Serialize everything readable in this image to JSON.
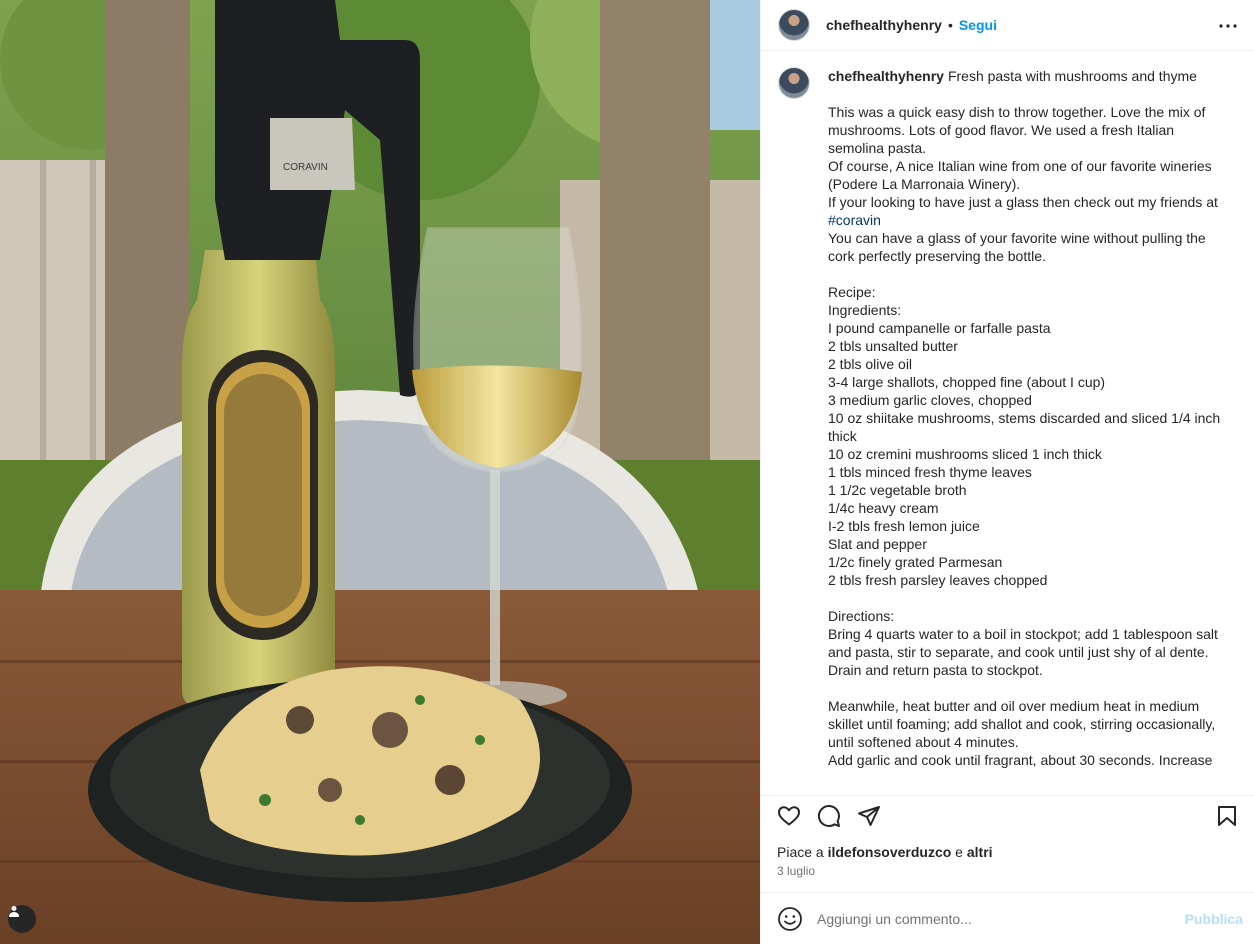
{
  "post": {
    "username": "chefhealthyhenry",
    "separator": "•",
    "follow_label": "Segui",
    "caption": {
      "username": "chefhealthyhenry",
      "title": "Fresh pasta with mushrooms and thyme",
      "line1": "This was a quick easy dish to throw together. Love the mix of mushrooms. Lots of good flavor. We used a fresh Italian semolina pasta.",
      "line2": "Of course, A nice Italian wine from one of our favorite wineries (Podere La Marronaia Winery).",
      "line3_prefix": "If your looking to have just a glass then check out my friends at ",
      "hashtag": "#coravin",
      "line4": "You can have a glass of your favorite wine without pulling the cork perfectly preserving the bottle.",
      "recipe_heading": "Recipe:",
      "ingredients_heading": "Ingredients:",
      "ingredients": [
        "I pound campanelle or farfalle pasta",
        "2 tbls unsalted butter",
        "2 tbls olive oil",
        "3-4 large shallots, chopped fine (about I cup)",
        "3 medium garlic cloves, chopped",
        "10 oz shiitake mushrooms, stems discarded and sliced 1/4 inch thick",
        "10 oz cremini mushrooms sliced 1 inch thick",
        "1 tbls minced fresh thyme leaves",
        "1 1/2c vegetable broth",
        "1/4c heavy cream",
        "I-2 tbls fresh lemon juice",
        "Slat and pepper",
        "1/2c finely grated Parmesan",
        "2 tbls fresh parsley leaves chopped"
      ],
      "directions_heading": "Directions:",
      "directions": [
        "Bring 4 quarts water to a boil in stockpot; add 1 tablespoon salt and pasta, stir to separate, and cook until just shy of al dente.",
        "Drain and return pasta to stockpot.",
        "",
        "Meanwhile, heat butter and oil over medium heat in medium skillet until foaming; add shallot and cook, stirring occasionally, until softened about 4 minutes.",
        "Add garlic and cook until fragrant, about 30 seconds. Increase"
      ]
    },
    "likes": {
      "prefix": "Piace a ",
      "user": "ildefonsoverduzco",
      "conjunction": " e ",
      "others": "altri"
    },
    "date": "3 luglio",
    "comment": {
      "placeholder": "Aggiungi un commento...",
      "publish_label": "Pubblica"
    }
  },
  "photo": {
    "bottle_brand": "CORAVIN"
  },
  "colors": {
    "accent": "#0095f6",
    "publish_disabled": "#b2dffc",
    "hashtag": "#00376b",
    "text": "#262626",
    "muted": "#737373"
  },
  "icons": [
    "more-icon",
    "heart-icon",
    "comment-icon",
    "share-icon",
    "bookmark-icon",
    "emoji-icon",
    "profile-icon"
  ]
}
